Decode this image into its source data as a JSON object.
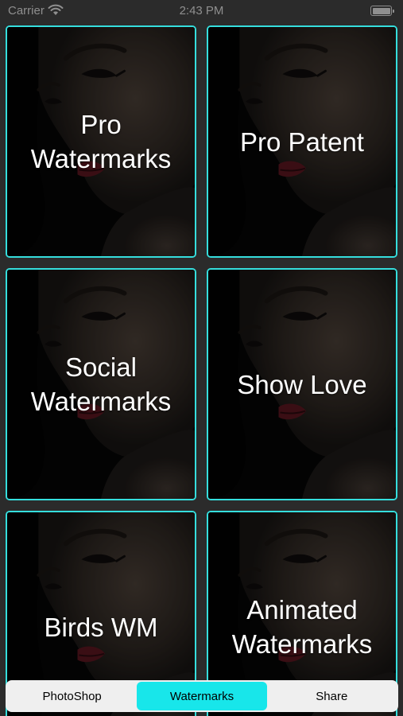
{
  "status_bar": {
    "carrier": "Carrier",
    "time": "2:43 PM",
    "icons": [
      "wifi-icon",
      "battery-icon"
    ],
    "color": "#8f8f8f"
  },
  "tiles": [
    {
      "label": "Pro\nWatermarks"
    },
    {
      "label": "Pro Patent"
    },
    {
      "label": "Social\nWatermarks"
    },
    {
      "label": "Show Love"
    },
    {
      "label": "Birds WM"
    },
    {
      "label": "Animated\nWatermarks"
    }
  ],
  "tab_bar": {
    "tabs": [
      {
        "label": "PhotoShop"
      },
      {
        "label": "Watermarks"
      },
      {
        "label": "Share"
      }
    ],
    "selected": "Watermarks"
  },
  "colors": {
    "background": "#2b2b2b",
    "tile_border": "#35dedd",
    "tab_active": "#18e6ea",
    "tab_bar": "#efefef"
  }
}
